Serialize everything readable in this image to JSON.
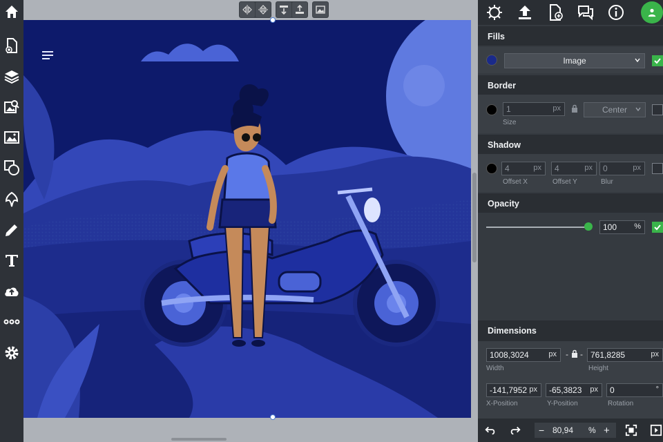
{
  "left_toolbar": {
    "tools": [
      "home-icon",
      "add-page-icon",
      "layers-icon",
      "image-search-icon",
      "image-icon",
      "shapes-icon",
      "clipart-icon",
      "pencil-icon",
      "text-icon",
      "upload-cloud-icon",
      "more-icon",
      "settings-icon"
    ]
  },
  "canvas_toolbar": {
    "tools": [
      "flip-horizontal-icon",
      "flip-vertical-icon",
      "send-backward-icon",
      "bring-forward-icon",
      "replace-image-icon"
    ]
  },
  "top_icons": [
    "effects-icon",
    "upload-icon",
    "add-file-icon",
    "comments-icon",
    "info-icon",
    "user-icon"
  ],
  "fills": {
    "header": "Fills",
    "type_value": "Image",
    "enabled": true
  },
  "border": {
    "header": "Border",
    "size_value": "1",
    "size_unit": "px",
    "size_label": "Size",
    "position_value": "Center",
    "enabled": false
  },
  "shadow": {
    "header": "Shadow",
    "offset_x_value": "4",
    "offset_x_label": "Offset X",
    "offset_y_value": "4",
    "offset_y_label": "Offset Y",
    "blur_value": "0",
    "blur_label": "Blur",
    "unit": "px",
    "enabled": false
  },
  "opacity": {
    "header": "Opacity",
    "value": "100",
    "unit": "%",
    "slider_fraction": 1.0,
    "enabled": true
  },
  "dimensions": {
    "header": "Dimensions",
    "width_value": "1008,3024",
    "width_label": "Width",
    "height_value": "761,8285",
    "height_label": "Height",
    "x_value": "-141,7952",
    "x_label": "X-Position",
    "y_value": "-65,3823",
    "y_label": "Y-Position",
    "rotation_value": "0",
    "rotation_label": "Rotation",
    "rotation_unit": "°",
    "unit": "px",
    "link_separator": "-"
  },
  "bottom_bar": {
    "zoom_value": "80,94",
    "zoom_unit": "%",
    "minus": "−",
    "plus": "+"
  },
  "colors": {
    "accent_green": "#3ab44a",
    "panel_dark": "#2a2e33",
    "panel": "#353a40",
    "art_navy": "#0d1a6b",
    "art_blue": "#4a63d6"
  }
}
